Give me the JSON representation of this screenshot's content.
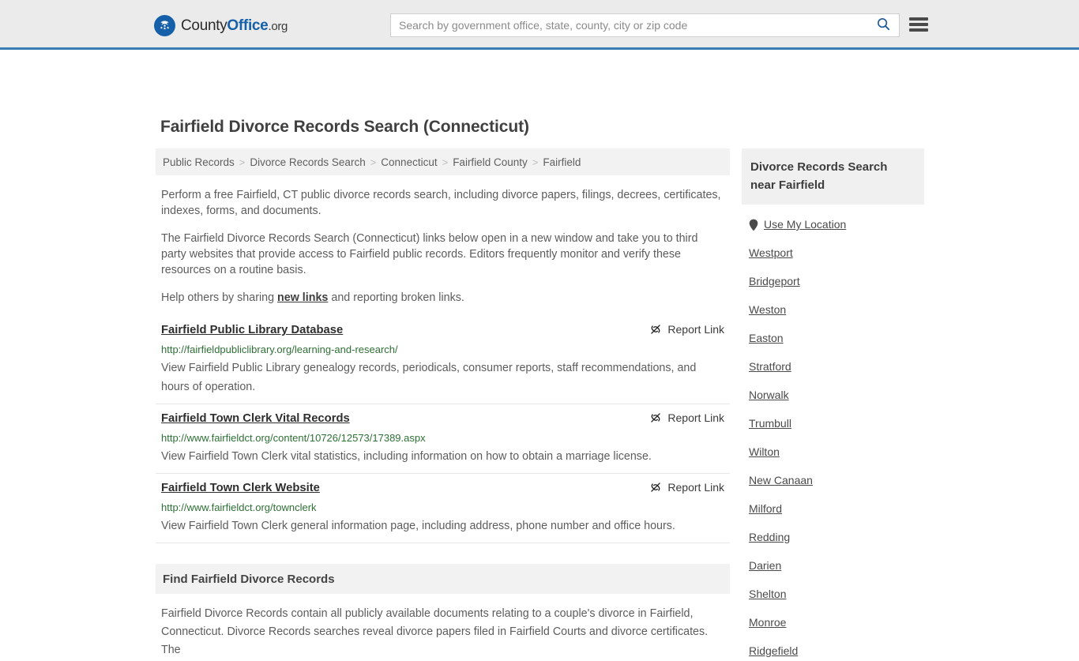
{
  "header": {
    "brand": {
      "part1": "County",
      "part2": "Office",
      "tld": ".org",
      "logo_icon": "eagle-stars-emblem"
    },
    "search": {
      "placeholder": "Search by government office, state, county, city or zip code",
      "value": "",
      "search_icon": "search-icon",
      "button_label": "Search"
    },
    "menu": {
      "icon": "hamburger-menu-icon",
      "label": "Menu"
    },
    "accent_color": "#3b7cb5",
    "background_color": "#ebebeb"
  },
  "page": {
    "title": "Fairfield Divorce Records Search (Connecticut)"
  },
  "breadcrumb": {
    "separator": ">",
    "items": [
      "Public Records",
      "Divorce Records Search",
      "Connecticut",
      "Fairfield County",
      "Fairfield"
    ]
  },
  "intro": {
    "p1": "Perform a free Fairfield, CT public divorce records search, including divorce papers, filings, decrees, certificates, indexes, forms, and documents.",
    "p2": "The Fairfield Divorce Records Search (Connecticut) links below open in a new window and take you to third party websites that provide access to Fairfield public records. Editors frequently monitor and verify these resources on a routine basis.",
    "p3_before": "Help others by sharing ",
    "p3_link": "new links",
    "p3_after": " and reporting broken links."
  },
  "results": {
    "report_label": "Report Link",
    "report_icon": "broken-link-icon",
    "items": [
      {
        "title": "Fairfield Public Library Database",
        "url": "http://fairfieldpubliclibrary.org/learning-and-research/",
        "description": "View Fairfield Public Library genealogy records, periodicals, consumer reports, staff recommendations, and hours of operation."
      },
      {
        "title": "Fairfield Town Clerk Vital Records",
        "url": "http://www.fairfieldct.org/content/10726/12573/17389.aspx",
        "description": "View Fairfield Town Clerk vital statistics, including information on how to obtain a marriage license."
      },
      {
        "title": "Fairfield Town Clerk Website",
        "url": "http://www.fairfieldct.org/townclerk",
        "description": "View Fairfield Town Clerk general information page, including address, phone number and office hours."
      }
    ]
  },
  "find_section": {
    "heading": "Find Fairfield Divorce Records",
    "body": "Fairfield Divorce Records contain all publicly available documents relating to a couple's divorce in Fairfield, Connecticut. Divorce Records searches reveal divorce papers filed in Fairfield Courts and divorce certificates. The"
  },
  "sidebar": {
    "heading": "Divorce Records Search near Fairfield",
    "use_my_location": {
      "label": "Use My Location",
      "icon": "map-pin-icon"
    },
    "places": [
      "Westport",
      "Bridgeport",
      "Weston",
      "Easton",
      "Stratford",
      "Norwalk",
      "Trumbull",
      "Wilton",
      "New Canaan",
      "Milford",
      "Redding",
      "Darien",
      "Shelton",
      "Monroe",
      "Ridgefield"
    ]
  },
  "colors": {
    "brand_blue": "#1560a8",
    "header_rule": "#3b7cb5",
    "url_green": "#2e7035",
    "panel_gray": "#f2f2f2"
  }
}
